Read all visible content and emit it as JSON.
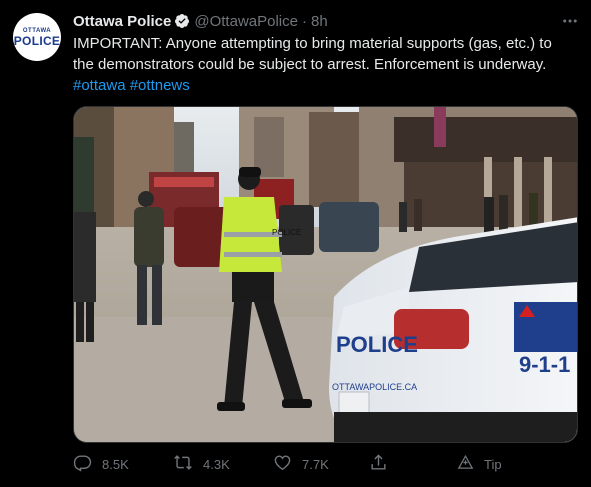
{
  "account": {
    "avatar_top": "OTTAWA",
    "avatar_main": "POLICE",
    "name": "Ottawa Police",
    "handle": "@OttawaPolice",
    "separator": "·",
    "time": "8h"
  },
  "tweet": {
    "text": "IMPORTANT: Anyone attempting to bring material supports (gas, etc.) to the demonstrators could be subject to arrest. Enforcement is underway.",
    "hashtag1": "#ottawa",
    "hashtag2": "#ottnews"
  },
  "photo": {
    "car_text": "POLICE",
    "car_number": "9-1-1",
    "car_url": "OTTAWAPOLICE.CA",
    "vest_text": "POLICE"
  },
  "actions": {
    "replies": "8.5K",
    "retweets": "4.3K",
    "likes": "7.7K",
    "tip": "Tip"
  },
  "colors": {
    "background": "#000000",
    "text": "#e7e9ea",
    "muted": "#71767b",
    "link": "#1d9bf0"
  },
  "icons": [
    "verified-icon",
    "more-icon",
    "reply-icon",
    "retweet-icon",
    "like-icon",
    "share-icon",
    "tip-icon"
  ]
}
